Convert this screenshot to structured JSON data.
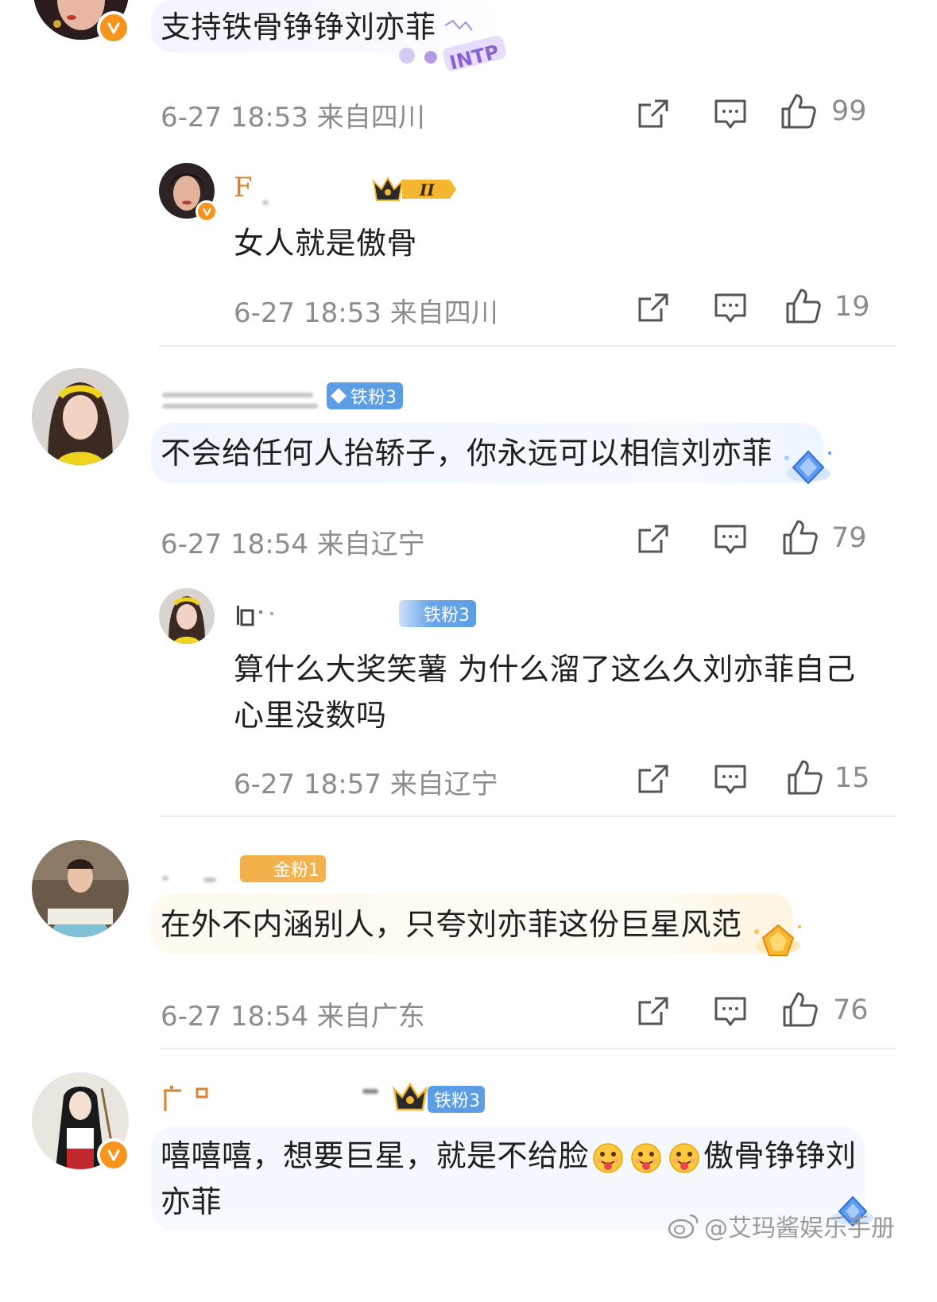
{
  "comments": [
    {
      "text": "支持铁骨铮铮刘亦菲",
      "sticker": "INTP",
      "meta": "6-27 18:53 来自四川",
      "likes": "99"
    },
    {
      "username": "F",
      "text": "女人就是傲骨",
      "level_badge": "II",
      "meta": "6-27 18:53 来自四川",
      "likes": "19"
    },
    {
      "fan_badge": "铁粉3",
      "text": "不会给任何人抬轿子，你永远可以相信刘亦菲",
      "meta": "6-27 18:54 来自辽宁",
      "likes": "79"
    },
    {
      "fan_badge": "铁粉3",
      "text": "算什么大奖笑薯 为什么溜了这么久刘亦菲自己心里没数吗",
      "meta": "6-27 18:57 来自辽宁",
      "likes": "15"
    },
    {
      "fan_badge": "金粉1",
      "text": "在外不内涵别人，只夸刘亦菲这份巨星风范",
      "meta": "6-27 18:54 来自广东",
      "likes": "76"
    },
    {
      "fan_badge": "铁粉3",
      "text_before_emoji": "嘻嘻嘻，想要巨星，就是不给脸",
      "text_after_emoji": "傲骨铮铮刘",
      "text_line2": "亦菲"
    }
  ],
  "watermark": "@艾玛酱娱乐手册",
  "colors": {
    "meta_gray": "#8c8c8c",
    "badge_orange": "#f7941d",
    "fan_blue": "#5b9ee6",
    "fan_gold": "#f3b14b"
  },
  "icons": [
    "share-icon",
    "comment-icon",
    "like-icon"
  ]
}
